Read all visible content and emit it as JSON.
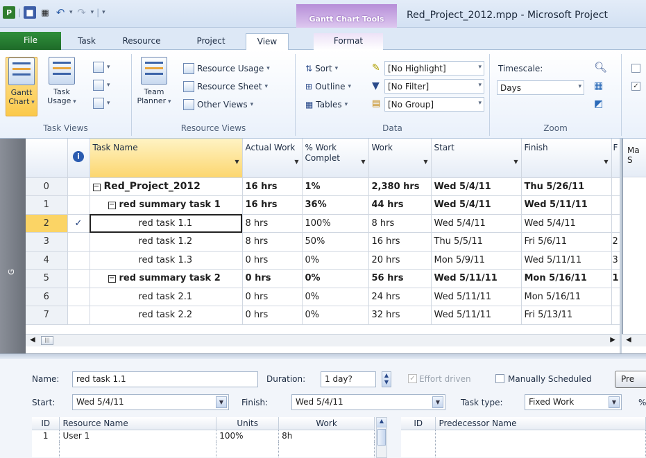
{
  "window": {
    "title": "Red_Project_2012.mpp - Microsoft Project",
    "context_tab_group": "Gantt Chart Tools",
    "app_icon": "project-icon"
  },
  "tabs": [
    {
      "label": "File"
    },
    {
      "label": "Task"
    },
    {
      "label": "Resource"
    },
    {
      "label": "Project"
    },
    {
      "label": "View",
      "active": true
    },
    {
      "label": "Format"
    }
  ],
  "ribbon": {
    "task_views": {
      "label": "Task Views",
      "gantt_chart": "Gantt Chart",
      "gantt_chart_l1": "Gantt",
      "gantt_chart_l2": "Chart",
      "task_usage_l1": "Task",
      "task_usage_l2": "Usage"
    },
    "resource_views": {
      "label": "Resource Views",
      "team_planner_l1": "Team",
      "team_planner_l2": "Planner",
      "resource_usage": "Resource Usage",
      "resource_sheet": "Resource Sheet",
      "other_views": "Other Views"
    },
    "data": {
      "label": "Data",
      "sort": "Sort",
      "outline": "Outline",
      "tables": "Tables",
      "highlight": "[No Highlight]",
      "filter": "[No Filter]",
      "group": "[No Group]"
    },
    "zoom": {
      "label": "Zoom",
      "timescale_label": "Timescale:",
      "timescale_value": "Days"
    }
  },
  "view_bar_label": "G",
  "grid": {
    "columns": [
      "Task Name",
      "Actual Work",
      "% Work Complet",
      "Work",
      "Start",
      "Finish",
      "F"
    ],
    "rows": [
      {
        "id": "0",
        "indicator": "",
        "name": "Red_Project_2012",
        "actual": "16 hrs",
        "pct": "1%",
        "work": "2,380 hrs",
        "start": "Wed 5/4/11",
        "finish": "Thu 5/26/11",
        "extra": "",
        "level": 0,
        "summary": true
      },
      {
        "id": "1",
        "indicator": "",
        "name": "red summary task 1",
        "actual": "16 hrs",
        "pct": "36%",
        "work": "44 hrs",
        "start": "Wed 5/4/11",
        "finish": "Wed 5/11/11",
        "extra": "",
        "level": 1,
        "summary": true
      },
      {
        "id": "2",
        "indicator": "✓",
        "name": "red task 1.1",
        "actual": "8 hrs",
        "pct": "100%",
        "work": "8 hrs",
        "start": "Wed 5/4/11",
        "finish": "Wed 5/4/11",
        "extra": "",
        "level": 2,
        "summary": false,
        "selected": true
      },
      {
        "id": "3",
        "indicator": "",
        "name": "red task 1.2",
        "actual": "8 hrs",
        "pct": "50%",
        "work": "16 hrs",
        "start": "Thu 5/5/11",
        "finish": "Fri 5/6/11",
        "extra": "2",
        "level": 2,
        "summary": false
      },
      {
        "id": "4",
        "indicator": "",
        "name": "red task 1.3",
        "actual": "0 hrs",
        "pct": "0%",
        "work": "20 hrs",
        "start": "Mon 5/9/11",
        "finish": "Wed 5/11/11",
        "extra": "3",
        "level": 2,
        "summary": false
      },
      {
        "id": "5",
        "indicator": "",
        "name": "red summary task 2",
        "actual": "0 hrs",
        "pct": "0%",
        "work": "56 hrs",
        "start": "Wed 5/11/11",
        "finish": "Mon 5/16/11",
        "extra": "1",
        "level": 1,
        "summary": true
      },
      {
        "id": "6",
        "indicator": "",
        "name": "red task 2.1",
        "actual": "0 hrs",
        "pct": "0%",
        "work": "24 hrs",
        "start": "Wed 5/11/11",
        "finish": "Mon 5/16/11",
        "extra": "",
        "level": 2,
        "summary": false
      },
      {
        "id": "7",
        "indicator": "",
        "name": "red task 2.2",
        "actual": "0 hrs",
        "pct": "0%",
        "work": "32 hrs",
        "start": "Wed 5/11/11",
        "finish": "Fri 5/13/11",
        "extra": "",
        "level": 2,
        "summary": false
      }
    ]
  },
  "chart_header": {
    "month": "Ma",
    "day": "S"
  },
  "form": {
    "name_label": "Name:",
    "name_value": "red task 1.1",
    "duration_label": "Duration:",
    "duration_value": "1 day?",
    "effort_driven": "Effort driven",
    "manually_scheduled": "Manually Scheduled",
    "prev_button": "Pre",
    "start_label": "Start:",
    "start_value": "Wed 5/4/11",
    "finish_label": "Finish:",
    "finish_value": "Wed 5/4/11",
    "task_type_label": "Task type:",
    "task_type_value": "Fixed Work",
    "pct_label": "%",
    "resources": {
      "columns": [
        "ID",
        "Resource Name",
        "Units",
        "Work"
      ],
      "rows": [
        {
          "id": "1",
          "name": "User 1",
          "units": "100%",
          "work": "8h"
        }
      ]
    },
    "predecessors": {
      "columns": [
        "ID",
        "Predecessor Name"
      ]
    }
  }
}
